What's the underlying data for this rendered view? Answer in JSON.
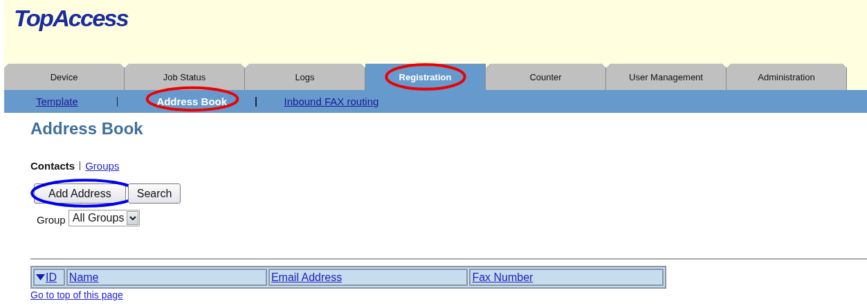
{
  "header": {
    "logo": "TopAccess"
  },
  "tabs": [
    {
      "label": "Device",
      "selected": false
    },
    {
      "label": "Job Status",
      "selected": false
    },
    {
      "label": "Logs",
      "selected": false
    },
    {
      "label": "Registration",
      "selected": true,
      "highlight": {
        "color": "#ee0000"
      }
    },
    {
      "label": "Counter",
      "selected": false
    },
    {
      "label": "User Management",
      "selected": false
    },
    {
      "label": "Administration",
      "selected": false
    }
  ],
  "subnav": [
    {
      "label": "Template",
      "selected": false
    },
    {
      "label": "Address Book",
      "selected": true,
      "highlight": {
        "color": "#ee0000"
      }
    },
    {
      "label": "Inbound FAX routing",
      "selected": false
    }
  ],
  "page_title": "Address Book",
  "views": [
    {
      "label": "Contacts",
      "selected": true
    },
    {
      "label": "Groups",
      "selected": false
    }
  ],
  "buttons": [
    {
      "label": "Add Address",
      "highlight": {
        "color": "#0000ee"
      }
    },
    {
      "label": "Search"
    }
  ],
  "group_filter": {
    "label": "Group",
    "value": "All Groups"
  },
  "table": {
    "columns": [
      {
        "label": "ID",
        "sorted": true
      },
      {
        "label": "Name",
        "sorted": false
      },
      {
        "label": "Email Address",
        "sorted": false
      },
      {
        "label": "Fax Number",
        "sorted": false
      }
    ]
  },
  "footer_link": "Go to top of this page"
}
